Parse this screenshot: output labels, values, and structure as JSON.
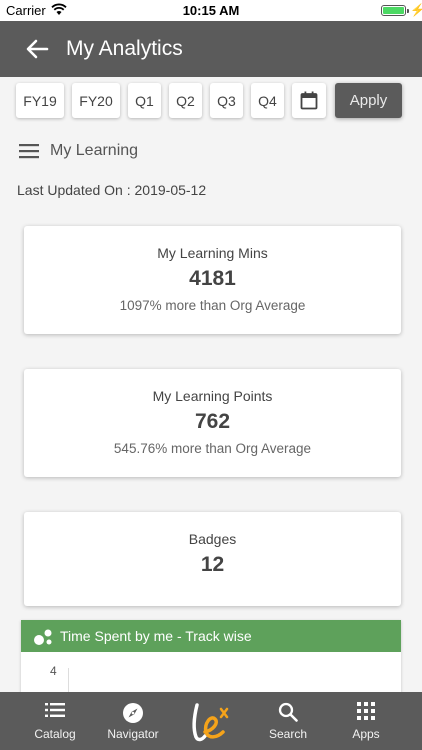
{
  "status_bar": {
    "carrier": "Carrier",
    "time": "10:15 AM"
  },
  "header": {
    "title": "My Analytics"
  },
  "filters": {
    "chips": [
      "FY19",
      "FY20",
      "Q1",
      "Q2",
      "Q3",
      "Q4"
    ],
    "apply_label": "Apply"
  },
  "section": {
    "title": "My Learning"
  },
  "last_updated": "Last Updated On : 2019-05-12",
  "cards": [
    {
      "label": "My Learning Mins",
      "value": "4181",
      "sub": "1097% more than Org Average"
    },
    {
      "label": "My Learning Points",
      "value": "762",
      "sub": "545.76% more than Org Average"
    },
    {
      "label": "Badges",
      "value": "12"
    }
  ],
  "track_chart": {
    "title": "Time Spent by me - Track wise",
    "y_tick_top": "4"
  },
  "bottom_nav": {
    "catalog": "Catalog",
    "navigator": "Navigator",
    "search": "Search",
    "apps": "Apps"
  },
  "colors": {
    "app_bar": "#5b5b5b",
    "accent_green": "#5ea15b",
    "battery": "#4cd964"
  }
}
